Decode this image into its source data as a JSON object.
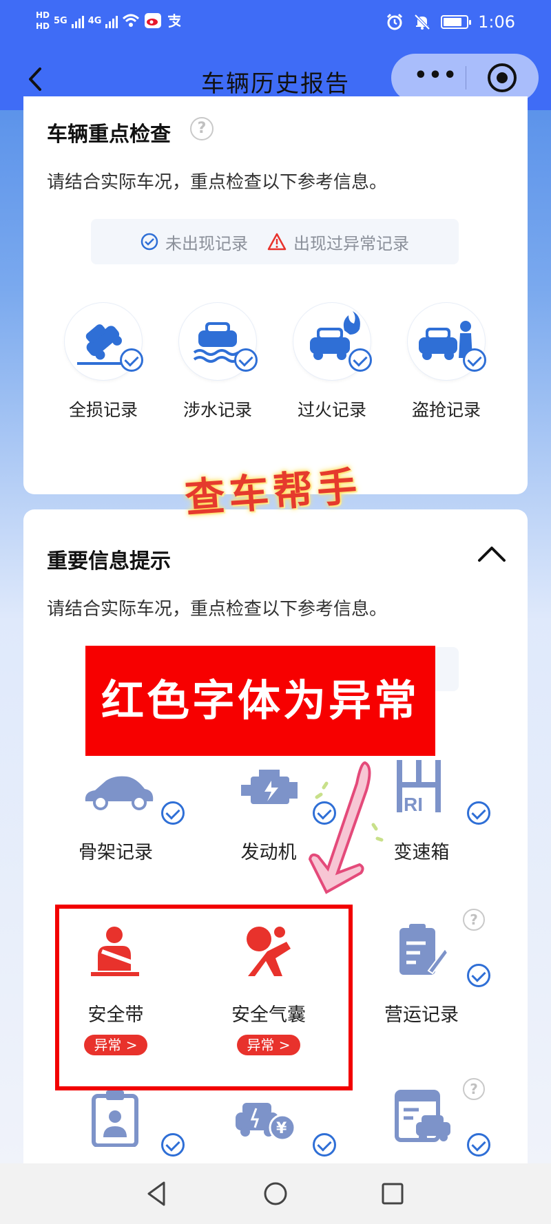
{
  "status_bar": {
    "hd1": "HD",
    "hd2": "HD",
    "net1": "5G",
    "net2": "4G",
    "time": "1:06",
    "icons": [
      "signal-icon",
      "wifi-icon",
      "weibo-icon",
      "alipay-icon",
      "alarm-icon",
      "mute-icon",
      "battery-icon"
    ]
  },
  "nav": {
    "title": "车辆历史报告",
    "more_label": "•••"
  },
  "key_check": {
    "title": "车辆重点检查",
    "help": "?",
    "description": "请结合实际车况，重点检查以下参考信息。",
    "legend": {
      "normal": "未出现记录",
      "abnormal": "出现过异常记录"
    },
    "items": [
      {
        "label": "全损记录",
        "icon": "total-loss-icon",
        "status": "normal"
      },
      {
        "label": "涉水记录",
        "icon": "flood-icon",
        "status": "normal"
      },
      {
        "label": "过火记录",
        "icon": "fire-icon",
        "status": "normal"
      },
      {
        "label": "盗抢记录",
        "icon": "theft-icon",
        "status": "normal"
      }
    ]
  },
  "important_info": {
    "title": "重要信息提示",
    "description": "请结合实际车况，重点检查以下参考信息。",
    "items": [
      {
        "label": "骨架记录",
        "icon": "car-frame-icon",
        "status": "normal"
      },
      {
        "label": "发动机",
        "icon": "engine-icon",
        "status": "normal"
      },
      {
        "label": "变速箱",
        "icon": "gearbox-icon",
        "status": "normal"
      },
      {
        "label": "安全带",
        "icon": "seatbelt-icon",
        "status": "abnormal",
        "tag": "异常 >"
      },
      {
        "label": "安全气囊",
        "icon": "airbag-icon",
        "status": "abnormal",
        "tag": "异常 >"
      },
      {
        "label": "营运记录",
        "icon": "operation-record-icon",
        "status": "normal",
        "help": "?"
      },
      {
        "label": "",
        "icon": "license-icon",
        "status": "normal"
      },
      {
        "label": "",
        "icon": "car-loan-icon",
        "status": "normal"
      },
      {
        "label": "",
        "icon": "car-document-icon",
        "status": "normal",
        "help": "?"
      }
    ]
  },
  "overlays": {
    "watermark": "查车帮手",
    "banner": "红色字体为异常"
  },
  "colors": {
    "primary_blue": "#3f6cf6",
    "icon_blue": "#2f6fd6",
    "icon_muted_blue": "#7d93c9",
    "abnormal_red": "#e8322c",
    "banner_red": "#f70000"
  }
}
